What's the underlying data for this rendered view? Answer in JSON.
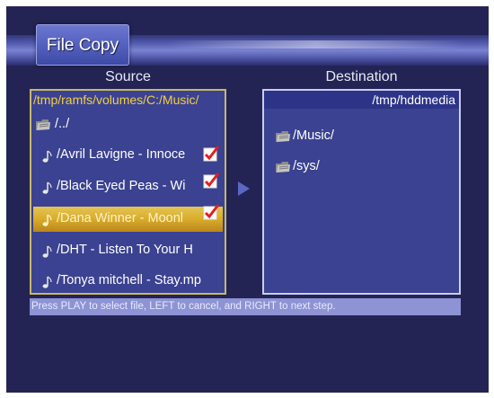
{
  "title": "File Copy",
  "source": {
    "heading": "Source",
    "path": "/tmp/ramfs/volumes/C:/Music/",
    "items": [
      {
        "label": "/../",
        "type": "folder",
        "checked": false,
        "selected": false
      },
      {
        "label": "/Avril Lavigne - Innoce",
        "type": "audio",
        "checked": true,
        "selected": false
      },
      {
        "label": "/Black Eyed Peas - Wi",
        "type": "audio",
        "checked": true,
        "selected": false
      },
      {
        "label": "/Dana Winner - Moonl",
        "type": "audio",
        "checked": true,
        "selected": true
      },
      {
        "label": "/DHT - Listen To Your H",
        "type": "audio",
        "checked": false,
        "selected": false
      },
      {
        "label": "/Tonya mitchell - Stay.mp",
        "type": "audio",
        "checked": false,
        "selected": false
      }
    ]
  },
  "destination": {
    "heading": "Destination",
    "path": "/tmp/hddmedia",
    "items": [
      {
        "label": "/Music/",
        "type": "folder"
      },
      {
        "label": "/sys/",
        "type": "folder"
      }
    ]
  },
  "status": "Press PLAY to select file, LEFT to cancel, and RIGHT to next step.",
  "colors": {
    "background": "#232454",
    "panel": "#3b4291",
    "source_border": "#c7b86a",
    "selection": "#d9ac2a",
    "path_text": "#f0d040",
    "status_bar": "#8d93d4"
  },
  "icons": {
    "folder": "folder-icon",
    "audio": "music-note-icon",
    "check": "checkmark-icon",
    "arrow": "arrow-right-icon"
  }
}
